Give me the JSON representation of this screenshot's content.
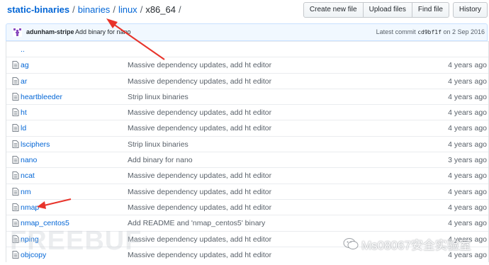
{
  "breadcrumb": {
    "repo": "static-binaries",
    "sep": "/",
    "parts": [
      "binaries",
      "linux"
    ],
    "current": "x86_64",
    "trail": "/"
  },
  "toolbar": {
    "create_label": "Create new file",
    "upload_label": "Upload files",
    "find_label": "Find file",
    "history_label": "History"
  },
  "commit": {
    "author": "adunham-stripe",
    "message": "Add binary for nano",
    "latest_prefix": "Latest commit",
    "sha": "cd9bf1f",
    "on": "on 2 Sep 2016"
  },
  "files": {
    "parent": "..",
    "rows": [
      {
        "name": "ag",
        "message": "Massive dependency updates, add ht editor",
        "age": "4 years ago"
      },
      {
        "name": "ar",
        "message": "Massive dependency updates, add ht editor",
        "age": "4 years ago"
      },
      {
        "name": "heartbleeder",
        "message": "Strip linux binaries",
        "age": "4 years ago"
      },
      {
        "name": "ht",
        "message": "Massive dependency updates, add ht editor",
        "age": "4 years ago"
      },
      {
        "name": "ld",
        "message": "Massive dependency updates, add ht editor",
        "age": "4 years ago"
      },
      {
        "name": "lsciphers",
        "message": "Strip linux binaries",
        "age": "4 years ago"
      },
      {
        "name": "nano",
        "message": "Add binary for nano",
        "age": "3 years ago"
      },
      {
        "name": "ncat",
        "message": "Massive dependency updates, add ht editor",
        "age": "4 years ago"
      },
      {
        "name": "nm",
        "message": "Massive dependency updates, add ht editor",
        "age": "4 years ago"
      },
      {
        "name": "nmap",
        "message": "Massive dependency updates, add ht editor",
        "age": "4 years ago"
      },
      {
        "name": "nmap_centos5",
        "message": "Add README and 'nmap_centos5' binary",
        "age": "4 years ago"
      },
      {
        "name": "nping",
        "message": "Massive dependency updates, add ht editor",
        "age": "4 years ago"
      },
      {
        "name": "objcopy",
        "message": "Massive dependency updates, add ht editor",
        "age": "4 years ago"
      }
    ]
  },
  "watermarks": {
    "freebuf": "FREEBUF",
    "wechat": "Ms08067安全实验室"
  },
  "colors": {
    "link": "#0366d6",
    "annotation_arrow": "#e8332a",
    "commit_bar_bg": "#f1f8ff"
  }
}
